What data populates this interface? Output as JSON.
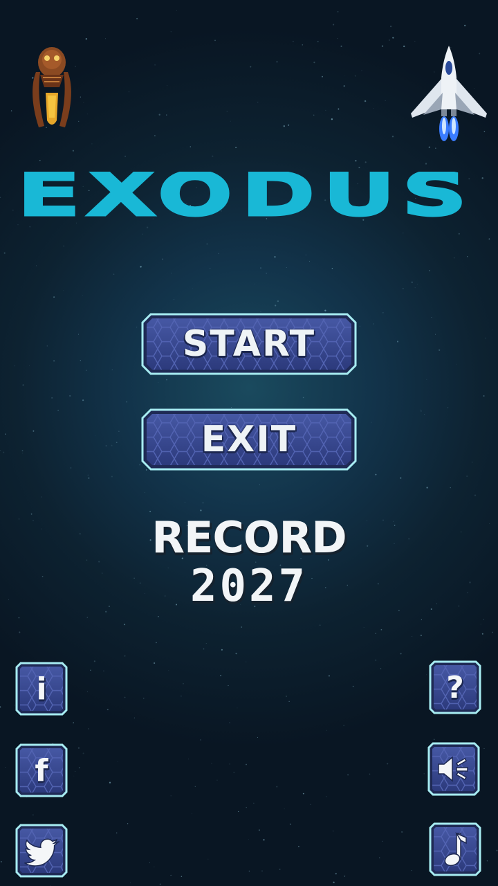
{
  "title": "EXODUS",
  "menu": {
    "start_label": "START",
    "exit_label": "EXIT"
  },
  "record": {
    "label": "RECORD",
    "value": "2027"
  },
  "side_buttons": {
    "info": "i",
    "facebook": "f",
    "help": "?"
  },
  "colors": {
    "logo": "#19b8d6",
    "button_fill": "#3a4a8e",
    "button_border": "#8fe0ea",
    "text": "#eef3f6"
  },
  "icons": [
    "alien-sprite",
    "spaceship-sprite",
    "info-icon",
    "facebook-icon",
    "twitter-icon",
    "help-icon",
    "sound-icon",
    "music-note-icon"
  ]
}
